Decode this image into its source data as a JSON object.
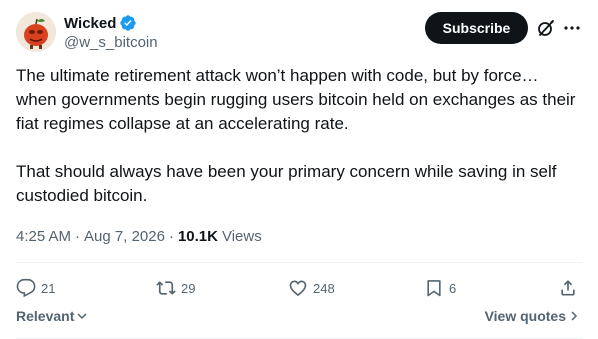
{
  "author": {
    "display_name": "Wicked",
    "handle": "@w_s_bitcoin",
    "verified": true,
    "verified_color": "#1d9bf0"
  },
  "header": {
    "subscribe_label": "Subscribe",
    "icons": [
      "grok-icon",
      "more-icon"
    ]
  },
  "tweet": {
    "text": "The ultimate retirement attack won’t happen with code, but by force… when governments begin rugging users bitcoin held on exchanges as their fiat regimes collapse at an accelerating rate.\n\nThat should always have been your primary concern while saving in self custodied bitcoin.",
    "time": "4:25 AM",
    "separator": "·",
    "date": "Aug 7, 2026",
    "views_count": "10.1K",
    "views_label": "Views"
  },
  "actions": {
    "replies": "21",
    "reposts": "29",
    "likes": "248",
    "bookmarks": "6"
  },
  "footer": {
    "sort_label": "Relevant",
    "view_quotes_label": "View quotes"
  }
}
